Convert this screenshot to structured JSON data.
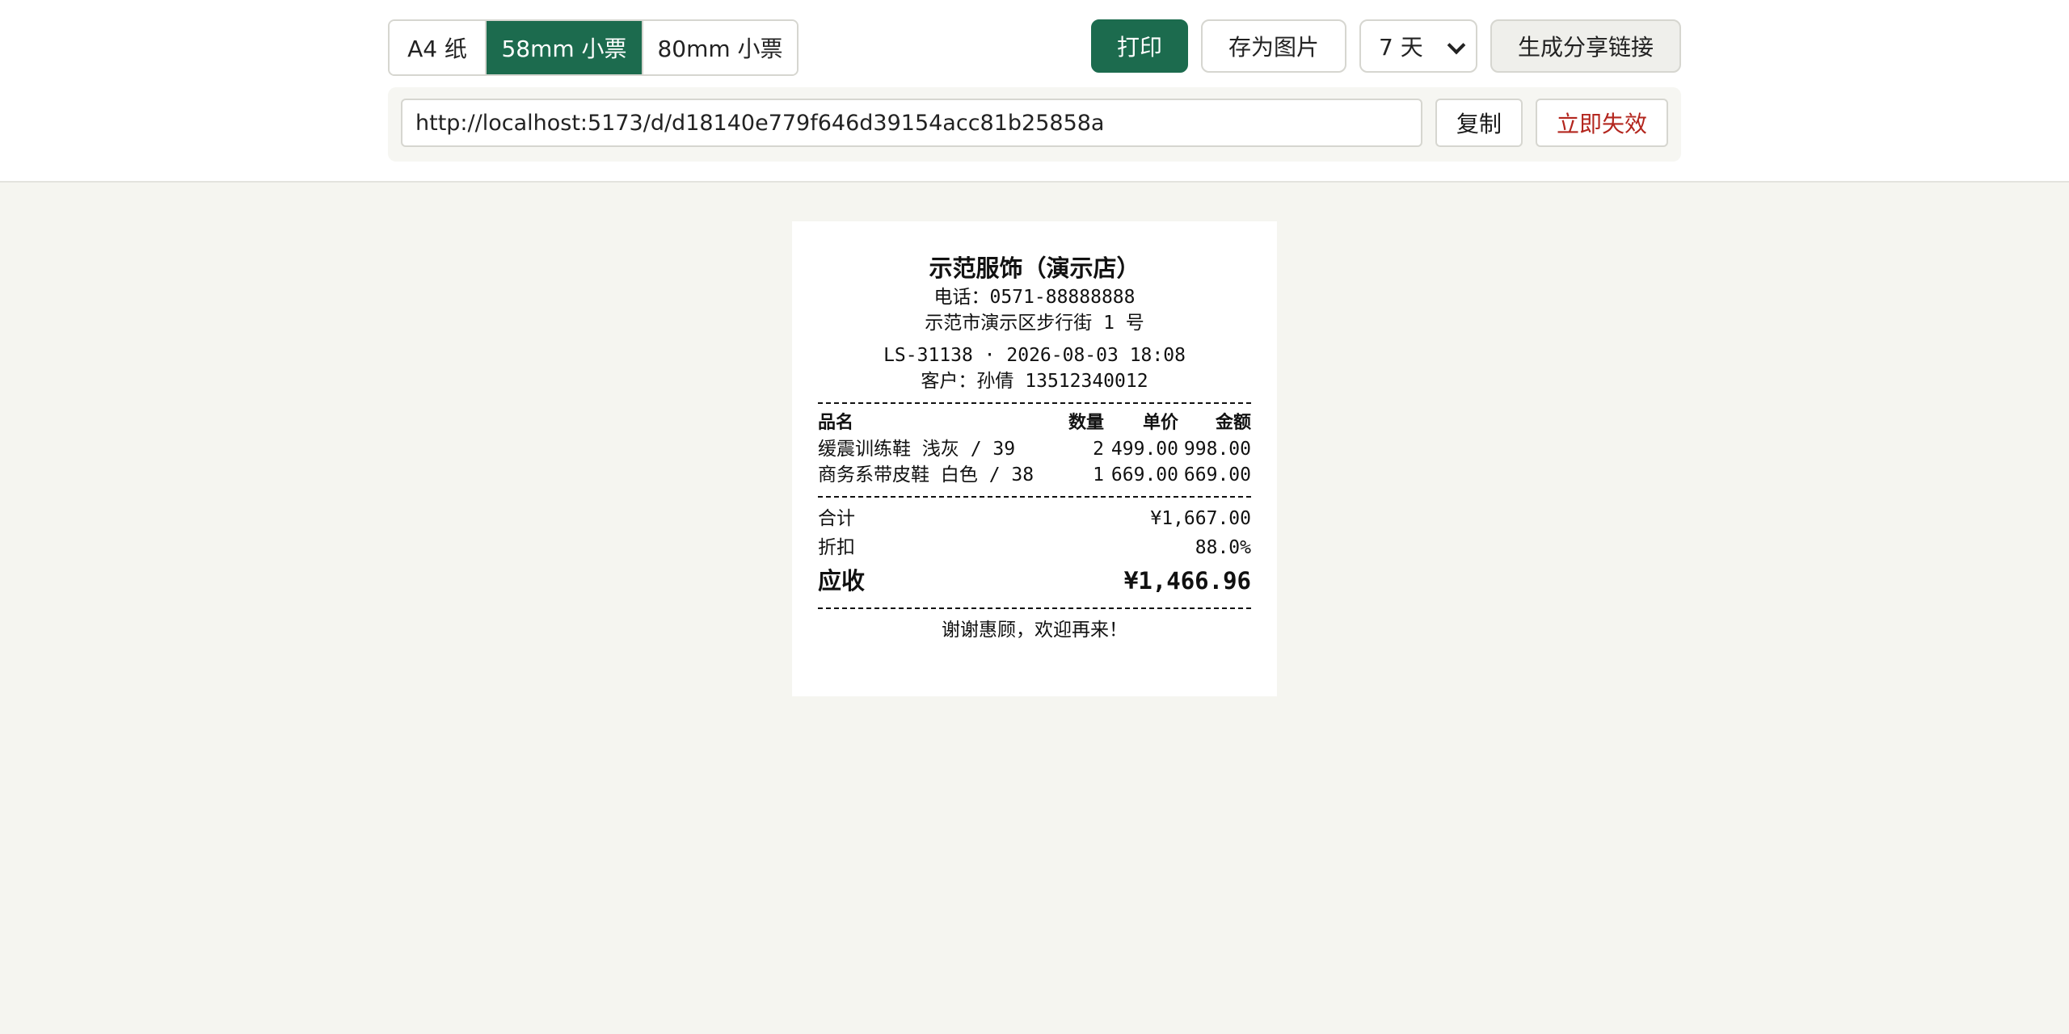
{
  "toolbar": {
    "paper_options": [
      {
        "label": "A4 纸",
        "active": false
      },
      {
        "label": "58mm 小票",
        "active": true
      },
      {
        "label": "80mm 小票",
        "active": false
      }
    ],
    "print_label": "打印",
    "save_image_label": "存为图片",
    "expiry_selected": "7 天",
    "share_label": "生成分享链接"
  },
  "share": {
    "url": "http://localhost:5173/d/d18140e779f646d39154acc81b25858a",
    "copy_label": "复制",
    "revoke_label": "立即失效"
  },
  "receipt": {
    "shop_name": "示范服饰（演示店）",
    "phone": "电话：0571-88888888",
    "address": "示范市演示区步行街 1 号",
    "order_line": "LS-31138 · 2026-08-03 18:08",
    "customer": "客户：孙倩 13512340012",
    "headers": {
      "name": "品名",
      "qty": "数量",
      "price": "单价",
      "amount": "金额"
    },
    "items": [
      {
        "name": "缓震训练鞋 浅灰 / 39",
        "qty": "2",
        "price": "499.00",
        "amount": "998.00"
      },
      {
        "name": "商务系带皮鞋 白色 / 38",
        "qty": "1",
        "price": "669.00",
        "amount": "669.00"
      }
    ],
    "subtotal_label": "合计",
    "subtotal_value": "¥1,667.00",
    "discount_label": "折扣",
    "discount_value": "88.0%",
    "due_label": "应收",
    "due_value": "¥1,466.96",
    "thanks": "谢谢惠顾，欢迎再来！"
  },
  "colors": {
    "accent": "#1c6b4e",
    "danger": "#b3261e",
    "background": "#f5f5f0"
  }
}
